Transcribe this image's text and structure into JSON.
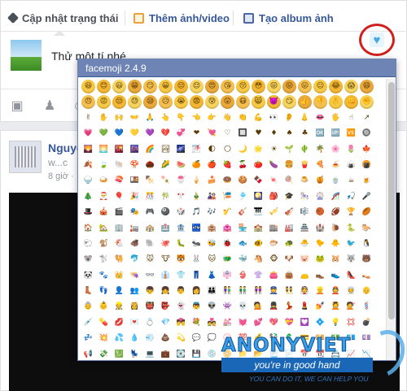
{
  "composer": {
    "tabs": [
      {
        "label": "Cập nhật trạng thái",
        "icon": "pencil-icon"
      },
      {
        "label": "Thêm ảnh/video",
        "icon": "photo-icon"
      },
      {
        "label": "Tạo album ảnh",
        "icon": "album-icon"
      }
    ],
    "status_text": "Thử một tí nhé",
    "heart_button_icon": "heart-icon",
    "highlight_color": "#d0201b",
    "actions": [
      {
        "name": "camera-icon",
        "glyph": "📷"
      },
      {
        "name": "tag-friends-icon",
        "glyph": "👤"
      },
      {
        "name": "feeling-icon",
        "glyph": "☺"
      }
    ]
  },
  "post": {
    "author": "Nguyễ",
    "sub": "w...c",
    "time": "8 giờ ·"
  },
  "popup": {
    "title": "facemoji 2.4.9",
    "emojis": [
      "😆",
      "😊",
      "😃",
      "😁",
      "😏",
      "😀",
      "😔",
      "😌",
      "😍",
      "😘",
      "😚",
      "😳",
      "😜",
      "😝",
      "😛",
      "😐",
      "😂",
      "😱",
      "😄",
      "😠",
      "😡",
      "😒",
      "😓",
      "😪",
      "😥",
      "😭",
      "😨",
      "😰",
      "😲",
      "😷",
      "😸",
      "👿",
      "😏",
      "👍",
      "👎",
      "👌",
      "👊",
      "✊",
      "✌",
      "✋",
      "🙌",
      "👐",
      "🙏",
      "👆",
      "👇",
      "👈",
      "👉",
      "👋",
      "👏",
      "💪",
      "👀",
      "👂",
      "👃",
      "👄",
      "🖐",
      "☝",
      "↗",
      "💗",
      "💚",
      "💙",
      "💛",
      "💜",
      "💔",
      "💞",
      "❤",
      "💘",
      "♡",
      "🔲",
      "♥",
      "♦",
      "♠",
      "♣",
      "🆗",
      "🆙",
      "🆚",
      "🔘",
      "🌄",
      "🌅",
      "🌇",
      "🌆",
      "🌈",
      "🏞",
      "🌌",
      "🌁",
      "🌓",
      "🌕",
      "🌙",
      "🌟",
      "☀",
      "🌱",
      "🌵",
      "🌴",
      "🌸",
      "🌷",
      "🍁",
      "🍂",
      "🍃",
      "🐚",
      "🍄",
      "🌰",
      "🌽",
      "🍉",
      "🍊",
      "🍎",
      "🍓",
      "🍒",
      "🍅",
      "🍆",
      "🍔",
      "🍟",
      "🍕",
      "🍝",
      "🍙",
      "🍘",
      "🍚",
      "🍛",
      "🍣",
      "🍱",
      "🍢",
      "🍡",
      "🍧",
      "🍦",
      "🍰",
      "🍩",
      "🍪",
      "🍫",
      "🍬",
      "🍭",
      "🍮",
      "🍯",
      "🍵",
      "☕",
      "🍺",
      "🎄",
      "🎅",
      "🎈",
      "🎉",
      "🎊",
      "🎋",
      "🎌",
      "🎍",
      "🎎",
      "🎏",
      "🎐",
      "🎑",
      "🎒",
      "🎓",
      "🎠",
      "🎡",
      "🎢",
      "🎣",
      "🎤",
      "🎩",
      "🎪",
      "🎬",
      "🎭",
      "🎮",
      "🎱",
      "🎲",
      "🎵",
      "🎶",
      "🎷",
      "🎸",
      "🎹",
      "🎺",
      "🎻",
      "🎼",
      "🏀",
      "🏈",
      "🏆",
      "🏉",
      "🏠",
      "🏡",
      "🏢",
      "🏣",
      "🏤",
      "🏥",
      "🏦",
      "🏧",
      "🏨",
      "🏩",
      "🏪",
      "🏫",
      "🏬",
      "🏭",
      "🏯",
      "🏰",
      "🐌",
      "🐍",
      "🐎",
      "🐑",
      "🐒",
      "🐔",
      "🐗",
      "🐘",
      "🐙",
      "🐛",
      "🐜",
      "🐝",
      "🐞",
      "🐟",
      "🐠",
      "🐡",
      "🐢",
      "🐣",
      "🐤",
      "🐥",
      "🐦",
      "🐧",
      "🐨",
      "🐩",
      "🐫",
      "🐬",
      "🐭",
      "🐮",
      "🐯",
      "🐰",
      "🐱",
      "🐲",
      "🐳",
      "🐴",
      "🐵",
      "🐶",
      "🐷",
      "🐸",
      "🐹",
      "🐺",
      "🐻",
      "🐼",
      "🐾",
      "👑",
      "👒",
      "👓",
      "👔",
      "👕",
      "👖",
      "👗",
      "👘",
      "👙",
      "👚",
      "👛",
      "👜",
      "👝",
      "👞",
      "👟",
      "👠",
      "👡",
      "👢",
      "👣",
      "👤",
      "👥",
      "👦",
      "👧",
      "👨",
      "👩",
      "👪",
      "👫",
      "👬",
      "👭",
      "👮",
      "👯",
      "👰",
      "👱",
      "👲",
      "👳",
      "👴",
      "👵",
      "👶",
      "👷",
      "👸",
      "👹",
      "👺",
      "👻",
      "👼",
      "👽",
      "👾",
      "💀",
      "💁",
      "💂",
      "💃",
      "💄",
      "💅",
      "💆",
      "💇",
      "💈",
      "💉",
      "💊",
      "💋",
      "💌",
      "💍",
      "💎",
      "💏",
      "💐",
      "💑",
      "💒",
      "💓",
      "💕",
      "💖",
      "💝",
      "💟",
      "💠",
      "💡",
      "💢",
      "💣",
      "💤",
      "💥",
      "💦",
      "💧",
      "💨",
      "💩",
      "💫",
      "💬",
      "💭",
      "💮",
      "💯",
      "💰",
      "💱",
      "💲",
      "💳",
      "💴",
      "💵",
      "💶",
      "💷",
      "📢",
      "💸",
      "💹",
      "💺",
      "💻",
      "💼",
      "💽",
      "💾",
      "💿",
      "📀",
      "📁",
      "📂",
      "📃",
      "📄",
      "📅",
      "📆",
      "📇",
      "📈",
      "📉",
      "🔨",
      "🔩",
      "🔪",
      "🔫",
      "🔬",
      "🔭",
      "🔮",
      "🔯",
      "🔰",
      "🔱",
      "🔲",
      "🔳",
      "🔴",
      "🔵",
      "🔶",
      "🔷",
      "🔸",
      "🔹",
      "🔺"
    ]
  },
  "watermark": {
    "title": "ANONYVIET",
    "tagline": "you're in good hand",
    "small": "YOU CAN DO IT, WE CAN HELP YOU"
  }
}
